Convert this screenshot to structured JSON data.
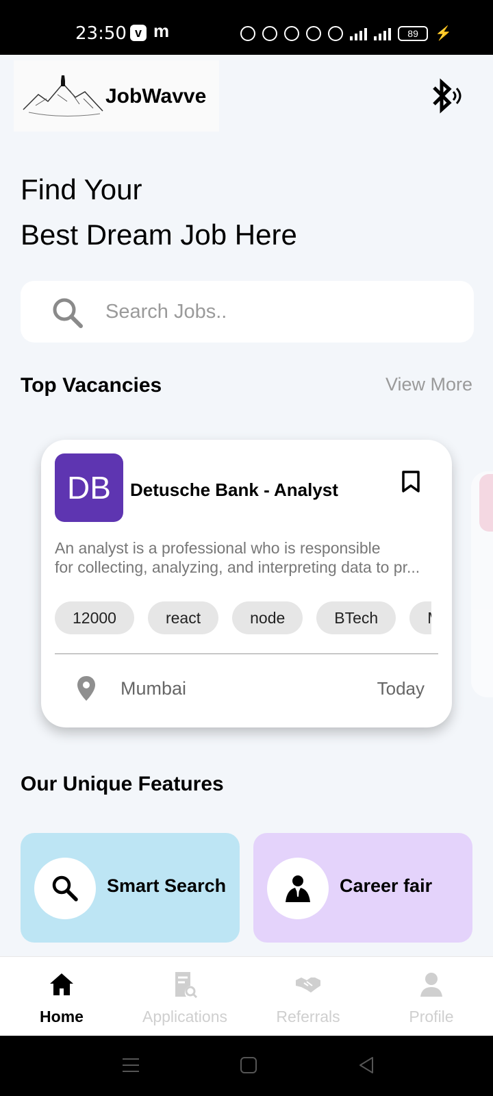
{
  "status_bar": {
    "time": "23:50",
    "app_v": "v",
    "app_m": "m",
    "battery": "89"
  },
  "header": {
    "app_name": "JobWavve"
  },
  "headline": {
    "line1": "Find Your",
    "line2": "Best Dream Job Here"
  },
  "search": {
    "placeholder": "Search Jobs.."
  },
  "top_vacancies": {
    "title": "Top Vacancies",
    "view_more": "View More",
    "job": {
      "logo_initials": "DB",
      "logo_color": "#5e35b1",
      "title": "Detusche Bank - Analyst",
      "description_line1": "An analyst is a professional who is responsible",
      "description_line2": "for collecting, analyzing, and interpreting data to pr...",
      "tags": [
        "12000",
        "react",
        "node",
        "BTech",
        "M"
      ],
      "location": "Mumbai",
      "posted": "Today"
    }
  },
  "features": {
    "title": "Our Unique Features",
    "items": [
      {
        "label": "Smart Search",
        "color": "#bde5f4"
      },
      {
        "label": "Career fair",
        "color": "#e4d3fb"
      }
    ]
  },
  "bottom_nav": {
    "items": [
      {
        "label": "Home",
        "active": true
      },
      {
        "label": "Applications",
        "active": false
      },
      {
        "label": "Referrals",
        "active": false
      },
      {
        "label": "Profile",
        "active": false
      }
    ],
    "active_color": "#000000",
    "inactive_color": "#cfcfcf"
  }
}
